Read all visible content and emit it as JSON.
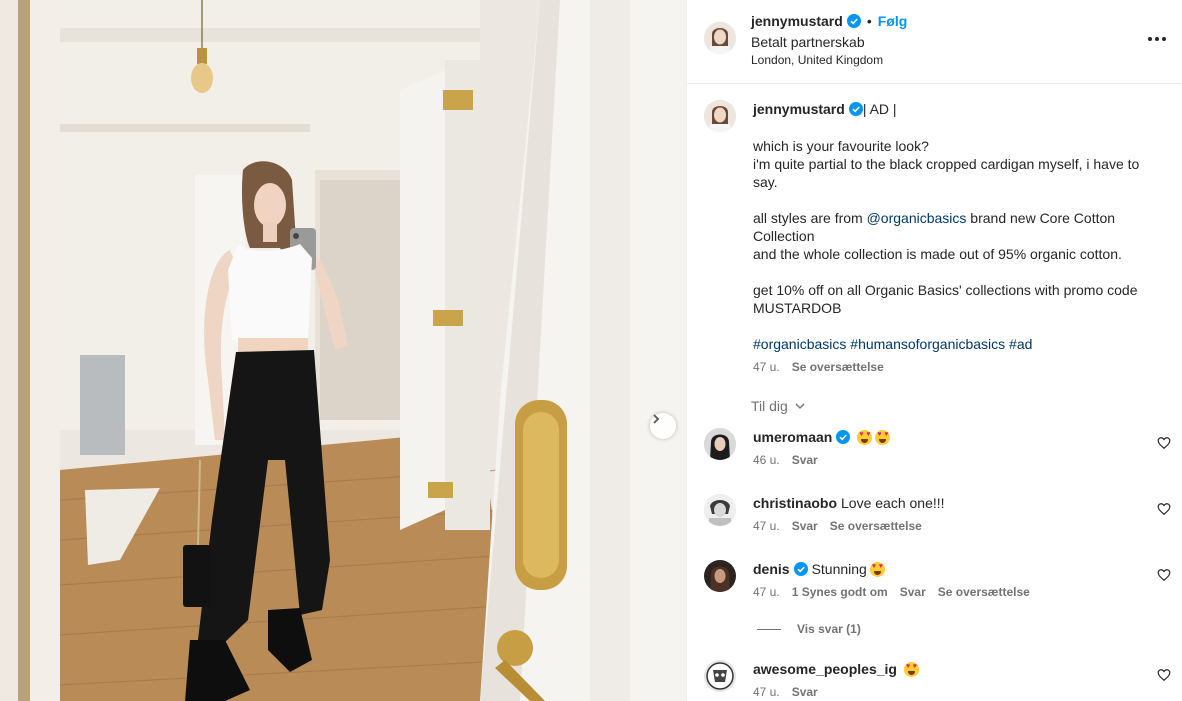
{
  "post": {
    "username": "jennymustard",
    "verified": true,
    "dot": "•",
    "follow_label": "Følg",
    "subtitle": "Betalt partnerskab",
    "location": "London, United Kingdom"
  },
  "caption": {
    "username": "jennymustard",
    "suffix": " | AD |",
    "line1": "which is your favourite look?",
    "line2": "i'm quite partial to the black cropped cardigan myself, i have to say.",
    "line3_prefix": "all styles are from ",
    "line3_mention": "@organicbasics",
    "line3_suffix": " brand new Core Cotton Collection",
    "line4": "and the whole collection is made out of 95% organic cotton.",
    "line5": "get 10% off on all Organic Basics' collections with promo code MUSTARDOB",
    "tag1": "#organicbasics",
    "tag2": "#humansoforganicbasics",
    "tag3": "#ad",
    "time": "47 u.",
    "translate": "Se oversættelse"
  },
  "sort_label": "Til dig",
  "comments": [
    {
      "username": "umeromaan",
      "verified": true,
      "text": "",
      "emojis": 2,
      "time": "46 u.",
      "reply": "Svar",
      "likes": "",
      "translate": ""
    },
    {
      "username": "christinaobo",
      "verified": false,
      "text": "Love each one!!!",
      "emojis": 0,
      "time": "47 u.",
      "reply": "Svar",
      "likes": "",
      "translate": "Se oversættelse"
    },
    {
      "username": "denis",
      "verified": true,
      "text": "Stunning",
      "emojis": 1,
      "time": "47 u.",
      "reply": "Svar",
      "likes": "1 Synes godt om",
      "translate": "Se oversættelse"
    },
    {
      "username": "awesome_peoples_ig",
      "verified": false,
      "text": "",
      "emojis": 1,
      "time": "47 u.",
      "reply": "Svar",
      "likes": "",
      "translate": ""
    }
  ],
  "view_replies": "Vis svar (1)",
  "icons": {
    "verified": "verified-badge-icon",
    "more": "more-options-icon",
    "next": "chevron-right-icon",
    "heart": "heart-outline-icon",
    "sort": "chevron-down-icon"
  },
  "colors": {
    "link": "#00376b",
    "follow": "#0095f6",
    "muted": "#737373",
    "verified": "#0095f6"
  }
}
